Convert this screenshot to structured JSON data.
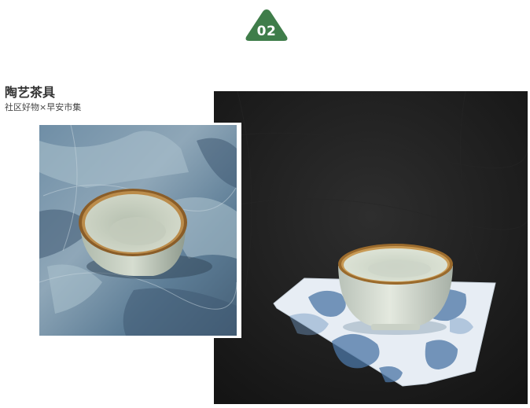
{
  "badge": {
    "number": "02",
    "color": "#3f7d4a"
  },
  "header": {
    "title": "陶艺茶具",
    "subtitle": "社区好物×早安市集"
  },
  "photos": [
    {
      "name": "tea-cup-on-blue-dyed-cloth"
    },
    {
      "name": "tea-cup-on-folded-indigo-napkin-dark-background"
    }
  ]
}
